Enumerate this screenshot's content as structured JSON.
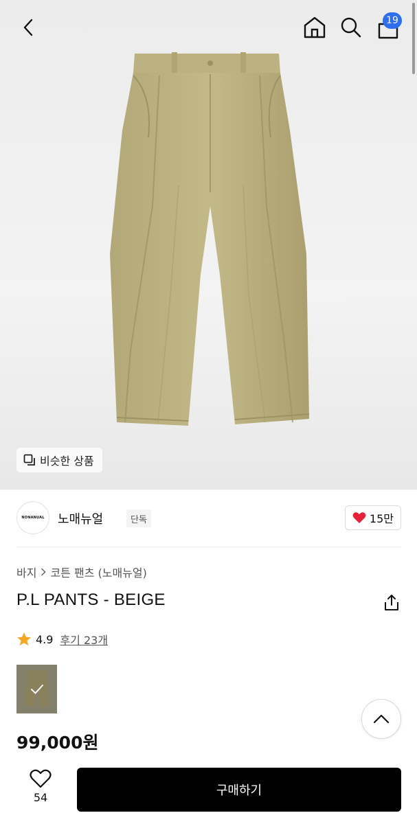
{
  "header": {
    "back_icon": "chevron-left-icon",
    "home_icon": "home-icon",
    "search_icon": "search-icon",
    "cart_icon": "shopping-bag-icon",
    "cart_count": "19"
  },
  "hero": {
    "similar_button_label": "비슷한 상품",
    "similar_icon": "copy-icon"
  },
  "brand": {
    "logo_text": "NONANUAL",
    "name": "노매뉴얼",
    "tag": "단독",
    "likes": "15만"
  },
  "product": {
    "breadcrumb": [
      "바지",
      "코튼 팬츠 (노매뉴얼)"
    ],
    "title": "P.L PANTS - BEIGE",
    "rating": "4.9",
    "reviews_label": "후기 23개",
    "price": "99,000원"
  },
  "bottom_bar": {
    "wish_count": "54",
    "buy_label": "구매하기"
  },
  "colors": {
    "badge": "#2e6ef0",
    "heart": "#e8213a",
    "star": "#f5a623",
    "buy_button": "#000000",
    "product": "#b9ae7f"
  }
}
